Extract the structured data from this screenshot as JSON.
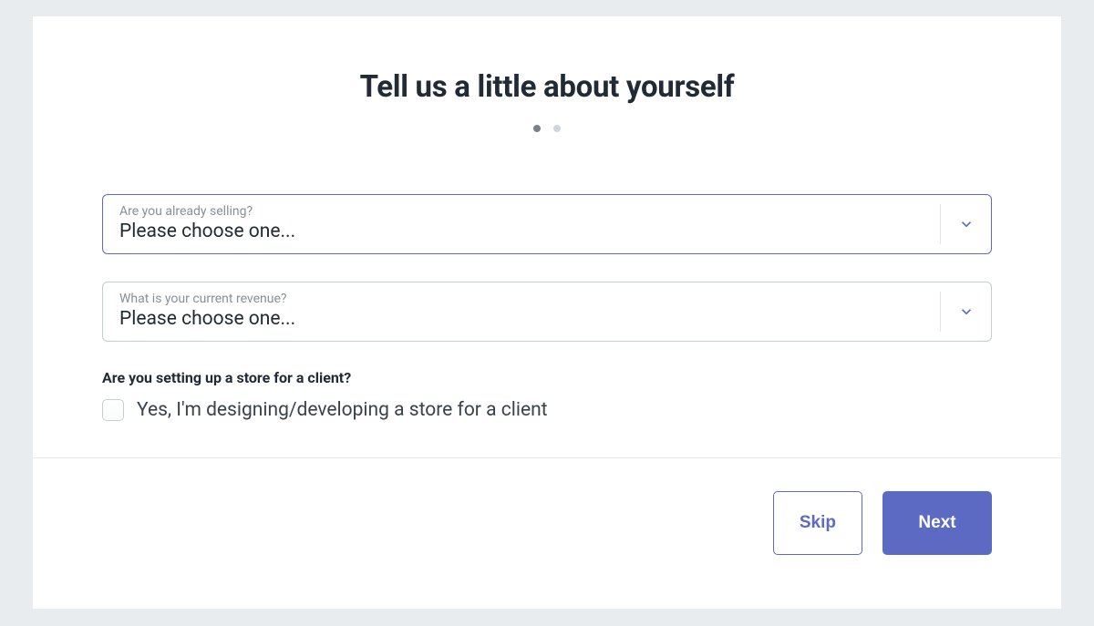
{
  "header": {
    "title": "Tell us a little about yourself",
    "step_active_index": 0,
    "total_steps": 2
  },
  "form": {
    "selling": {
      "label": "Are you already selling?",
      "value": "Please choose one..."
    },
    "revenue": {
      "label": "What is your current revenue?",
      "value": "Please choose one..."
    },
    "client": {
      "question": "Are you setting up a store for a client?",
      "checkbox_label": "Yes, I'm designing/developing a store for a client",
      "checked": false
    }
  },
  "footer": {
    "skip_label": "Skip",
    "next_label": "Next"
  }
}
